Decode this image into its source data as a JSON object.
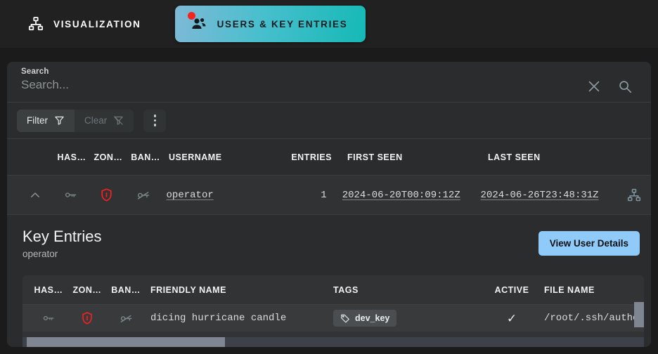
{
  "nav": {
    "tabs": [
      {
        "label": "VISUALIZATION",
        "icon": "sitemap-icon",
        "active": false
      },
      {
        "label": "USERS & KEY ENTRIES",
        "icon": "users-icon",
        "active": true,
        "badge": true
      }
    ]
  },
  "search": {
    "label": "Search",
    "placeholder": "Search...",
    "value": "",
    "clear_icon": "close-icon",
    "search_icon": "search-icon"
  },
  "toolbar": {
    "filter_label": "Filter",
    "clear_label": "Clear",
    "filter_icon": "funnel-icon",
    "clear_icon": "funnel-off-icon",
    "more_icon": "more-vertical-icon"
  },
  "users_table": {
    "columns": [
      "HAS…",
      "ZON…",
      "BAN…",
      "USERNAME",
      "ENTRIES",
      "FIRST SEEN",
      "LAST SEEN"
    ],
    "rows": [
      {
        "expand_icon": "chevron-up-icon",
        "has_key_icon": "key-icon",
        "zone_icon": "shield-alert-icon",
        "banned_icon": "key-off-icon",
        "username": "operator",
        "entries": "1",
        "first_seen": "2024-06-20T00:09:12Z",
        "last_seen": "2024-06-26T23:48:31Z",
        "action_icon": "sitemap-icon"
      }
    ]
  },
  "key_entries": {
    "title": "Key Entries",
    "subtitle": "operator",
    "button_label": "View User Details",
    "columns": [
      "HAS…",
      "ZON…",
      "BAN…",
      "FRIENDLY NAME",
      "TAGS",
      "ACTIVE",
      "FILE NAME"
    ],
    "rows": [
      {
        "has_key_icon": "key-icon",
        "zone_icon": "shield-alert-icon",
        "banned_icon": "key-off-icon",
        "friendly_name": "dicing hurricane candle",
        "tag": "dev_key",
        "tag_icon": "tag-icon",
        "active": "✓",
        "file_name": "/root/.ssh/author"
      }
    ]
  },
  "colors": {
    "accent_button": "#90caf9",
    "tab_gradient_start": "#7fb9d6",
    "tab_gradient_end": "#15b9b6",
    "badge": "#f4231f",
    "alert": "#ff1f1f",
    "page_bg": "#1b1b1b",
    "card_bg": "#2a2c2d"
  }
}
